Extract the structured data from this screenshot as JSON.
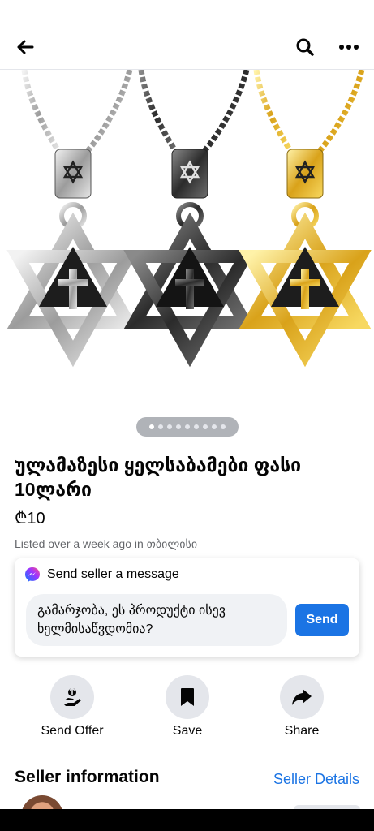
{
  "header": {
    "back_icon": "arrow-left-icon",
    "search_icon": "search-icon",
    "more_icon": "more-horizontal-icon"
  },
  "gallery": {
    "image_description": "three star of david pendants with cross: silver, black, gold",
    "dot_count": 9,
    "active_index": 0
  },
  "listing": {
    "title": "ულამაზესი ყელსაბამები ფასი 10ლარი",
    "price": "₾10",
    "meta": "Listed over a week ago in თბილისი"
  },
  "message_card": {
    "icon": "messenger-icon",
    "heading": "Send seller a message",
    "message_value": "გამარჯობა, ეს პროდუქტი ისევ ხელმისაწვდომია?",
    "send_label": "Send"
  },
  "actions": [
    {
      "label": "Send Offer",
      "icon": "send-offer-icon"
    },
    {
      "label": "Save",
      "icon": "bookmark-icon"
    },
    {
      "label": "Share",
      "icon": "share-icon"
    }
  ],
  "seller": {
    "heading": "Seller information",
    "details_link": "Seller Details"
  },
  "colors": {
    "accent": "#1b74e4",
    "gray_bg": "#e4e6eb",
    "text_secondary": "#65676b"
  }
}
